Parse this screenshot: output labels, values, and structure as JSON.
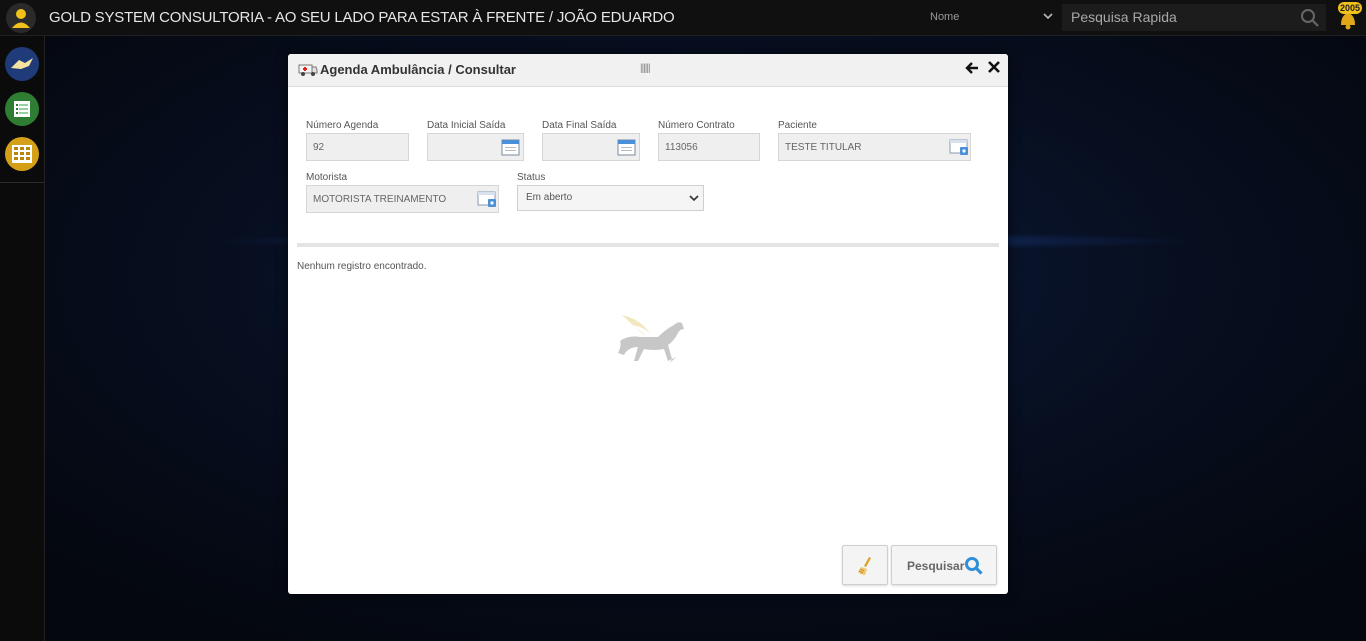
{
  "header": {
    "title": "GOLD SYSTEM CONSULTORIA - AO SEU LADO PARA ESTAR À FRENTE / JOÃO EDUARDO",
    "search_field_option": "Nome",
    "search_placeholder": "Pesquisa Rapida",
    "notification_count": "2005"
  },
  "dialog": {
    "title": "Agenda Ambulância / Consultar",
    "handle": "||||||",
    "fields": {
      "numero_agenda": {
        "label": "Número Agenda",
        "value": "92"
      },
      "data_inicial": {
        "label": "Data Inicial Saída",
        "value": ""
      },
      "data_final": {
        "label": "Data Final Saída",
        "value": ""
      },
      "numero_contrato": {
        "label": "Número Contrato",
        "value": "113056"
      },
      "paciente": {
        "label": "Paciente",
        "value": "TESTE TITULAR"
      },
      "motorista": {
        "label": "Motorista",
        "value": "MOTORISTA TREINAMENTO"
      },
      "status": {
        "label": "Status",
        "value": "Em aberto"
      }
    },
    "empty_message": "Nenhum registro encontrado.",
    "buttons": {
      "search_label": "Pesquisar"
    }
  },
  "colors": {
    "notification_badge": "#f2c21a",
    "sidebar_blue": "#1f3b7a",
    "sidebar_green": "#2e7d32",
    "sidebar_yellow": "#d4a017",
    "search_icon": "#2f8fd8"
  }
}
